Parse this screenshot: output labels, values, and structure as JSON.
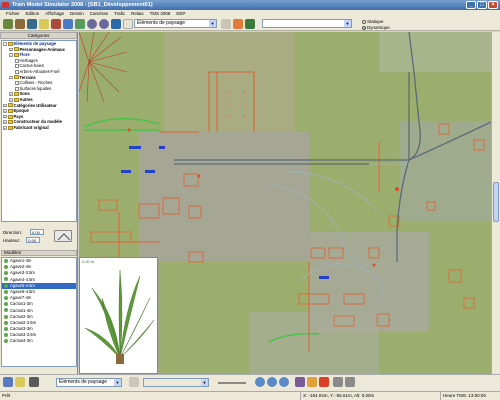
{
  "window": {
    "title": "Train Model Simulator 2008 - [SB1_Développement01]"
  },
  "menu": [
    "Fichier",
    "Edition",
    "Affichage",
    "Dessin",
    "Caméras",
    "Trafic",
    "Relais",
    "TMS 2008",
    "EEP"
  ],
  "toolbar": {
    "category_combo": "Eléments de paysage",
    "search_value": "",
    "radio_static": "Statique",
    "radio_dynamic": "Dynamique",
    "static_checked": false,
    "dynamic_checked": true
  },
  "left": {
    "header": "Catégories",
    "tree": [
      {
        "label": "Eléments de paysage",
        "level": 0,
        "bold": true,
        "blue": true,
        "exp": "-"
      },
      {
        "label": "Personnages-Animaux",
        "level": 1,
        "bold": true,
        "exp": "+"
      },
      {
        "label": "Flore",
        "level": 1,
        "bold": true,
        "blue": true,
        "exp": "-"
      },
      {
        "label": "Herbages",
        "level": 2,
        "doc": true
      },
      {
        "label": "Cactus-haies",
        "level": 2,
        "doc": true
      },
      {
        "label": "Arbres-Arbustes-Forê",
        "level": 2,
        "doc": true
      },
      {
        "label": "Terrains",
        "level": 1,
        "bold": true,
        "exp": "-"
      },
      {
        "label": "Collines - Roches",
        "level": 2,
        "doc": true
      },
      {
        "label": "Surfaces liquides",
        "level": 2,
        "doc": true
      },
      {
        "label": "Sons",
        "level": 1,
        "bold": true,
        "exp": "+"
      },
      {
        "label": "Autres",
        "level": 1,
        "bold": true,
        "exp": "+"
      },
      {
        "label": "Catégories Utilisateur",
        "level": 0,
        "bold": true,
        "exp": "+"
      },
      {
        "label": "Epoque",
        "level": 0,
        "bold": true,
        "exp": "+"
      },
      {
        "label": "Pays",
        "level": 0,
        "bold": true,
        "exp": "+"
      },
      {
        "label": "Constructeur du modèle",
        "level": 0,
        "bold": true,
        "exp": "+"
      },
      {
        "label": "Fabricant original",
        "level": 0,
        "bold": true,
        "exp": "+"
      }
    ],
    "direction_label": "Direction:",
    "direction_value": "0.00",
    "hauteur_label": "Hauteur:",
    "hauteur_value": "0.00",
    "modeles_header": "Modèles",
    "models": [
      {
        "label": "Agave1-4m",
        "selected": false
      },
      {
        "label": "Agave2-4m",
        "selected": false
      },
      {
        "label": "Agave3-3.5m",
        "selected": false
      },
      {
        "label": "Agave4-4.5m",
        "selected": false
      },
      {
        "label": "Agave5-4.5m",
        "selected": true
      },
      {
        "label": "Agave6-4.5m",
        "selected": false
      },
      {
        "label": "Agave7-4m",
        "selected": false
      },
      {
        "label": "Cactus1-3m",
        "selected": false
      },
      {
        "label": "Cactus1-4m",
        "selected": false
      },
      {
        "label": "Cactus2-3m",
        "selected": false
      },
      {
        "label": "Cactus2-3.5m",
        "selected": false
      },
      {
        "label": "Cactus3-3m",
        "selected": false
      },
      {
        "label": "Cactus3-3.5m",
        "selected": false
      },
      {
        "label": "Cactus4-3m",
        "selected": false
      }
    ],
    "preview_label": "0.00 m"
  },
  "bottom": {
    "combo": "Eléments de paysage"
  },
  "status": {
    "left": "Prêt",
    "coords": "X: -194.04m, Y: -55.61m, Alt: 0.00m",
    "time": "Heure TMS: 13:50:00"
  },
  "colors": {
    "grass": "#9cae6e",
    "selection": "#316ac5",
    "title_bar": "#3f6fae"
  }
}
